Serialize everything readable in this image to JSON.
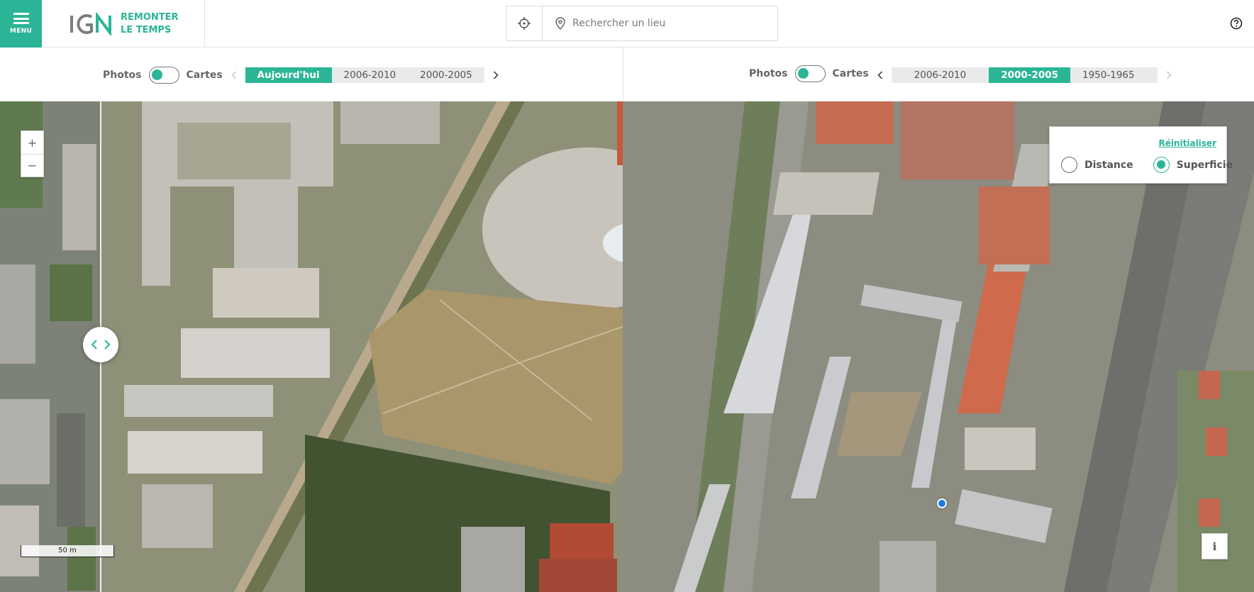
{
  "header": {
    "menu_label": "MENU",
    "brand_line1": "REMONTER",
    "brand_line2": "LE TEMPS",
    "search_placeholder": "Rechercher un lieu"
  },
  "left_selector": {
    "photos_label": "Photos",
    "cartes_label": "Cartes",
    "years": [
      {
        "label": "Aujourd'hui",
        "active": true
      },
      {
        "label": "2006-2010",
        "active": false
      },
      {
        "label": "2000-2005",
        "active": false
      }
    ]
  },
  "right_selector": {
    "photos_label": "Photos",
    "cartes_label": "Cartes",
    "years": [
      {
        "label": "2006-2010",
        "active": false
      },
      {
        "label": "2000-2005",
        "active": true
      },
      {
        "label": "1950-1965",
        "active": false
      }
    ]
  },
  "map": {
    "zoom_in": "+",
    "zoom_out": "−",
    "scale_label": "50 m",
    "info_label": "i"
  },
  "measure": {
    "reset_label": "Réinitialiser",
    "distance_label": "Distance",
    "surface_label": "Superficie",
    "selected": "Superficie"
  },
  "colors": {
    "accent": "#2bb596",
    "location_dot": "#1a7fe0"
  },
  "icons": [
    "menu-icon",
    "ign-logo",
    "crosshair-icon",
    "location-pin-icon",
    "help-icon",
    "chevron-left-icon",
    "chevron-right-icon",
    "swipe-handle-icon"
  ]
}
